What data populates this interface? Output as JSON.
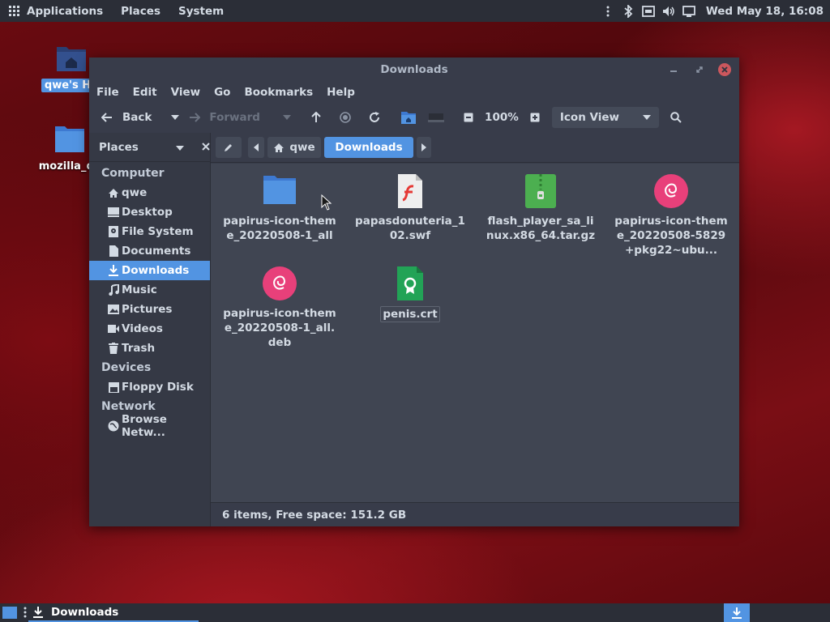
{
  "top_panel": {
    "menus": [
      "Applications",
      "Places",
      "System"
    ],
    "clock": "Wed May 18, 16:08"
  },
  "desktop": {
    "icons": [
      {
        "label": "qwe's Ho",
        "icon": "home-folder-icon"
      },
      {
        "label": "mozilla_qv",
        "icon": "folder-icon"
      }
    ]
  },
  "window": {
    "title": "Downloads",
    "menubar": [
      "File",
      "Edit",
      "View",
      "Go",
      "Bookmarks",
      "Help"
    ],
    "toolbar": {
      "back": "Back",
      "forward": "Forward",
      "zoom": "100%",
      "view_mode": "Icon View"
    },
    "sidebar": {
      "header": "Places",
      "sections": [
        {
          "title": "Computer",
          "items": [
            {
              "label": "qwe",
              "icon": "home-icon"
            },
            {
              "label": "Desktop",
              "icon": "desktop-icon"
            },
            {
              "label": "File System",
              "icon": "drive-icon"
            },
            {
              "label": "Documents",
              "icon": "document-icon"
            },
            {
              "label": "Downloads",
              "icon": "download-icon",
              "active": true
            },
            {
              "label": "Music",
              "icon": "music-icon"
            },
            {
              "label": "Pictures",
              "icon": "picture-icon"
            },
            {
              "label": "Videos",
              "icon": "video-icon"
            },
            {
              "label": "Trash",
              "icon": "trash-icon"
            }
          ]
        },
        {
          "title": "Devices",
          "items": [
            {
              "label": "Floppy Disk",
              "icon": "floppy-icon"
            }
          ]
        },
        {
          "title": "Network",
          "items": [
            {
              "label": "Browse Netw...",
              "icon": "network-icon"
            }
          ]
        }
      ]
    },
    "location": {
      "crumbs": [
        "qwe",
        "Downloads"
      ]
    },
    "files": [
      {
        "name": "papirus-icon-theme_20220508-1_all",
        "type": "folder"
      },
      {
        "name": "papasdonuteria_102.swf",
        "type": "flash"
      },
      {
        "name": "flash_player_sa_linux.x86_64.tar.gz",
        "type": "archive"
      },
      {
        "name": "papirus-icon-theme_20220508-5829+pkg22~ubu...",
        "type": "deb"
      },
      {
        "name": "papirus-icon-theme_20220508-1_all.deb",
        "type": "deb"
      },
      {
        "name": "penis.crt",
        "type": "certificate"
      }
    ],
    "status": "6 items, Free space: 151.2 GB"
  },
  "bottom_panel": {
    "task_label": "Downloads"
  },
  "colors": {
    "accent": "#5294e2",
    "window_bg": "#383c4a",
    "content_bg": "#404552",
    "deb_pink": "#e8407a",
    "archive_green": "#4caf50",
    "cert_green": "#22a356",
    "close_red": "#cc575d"
  }
}
